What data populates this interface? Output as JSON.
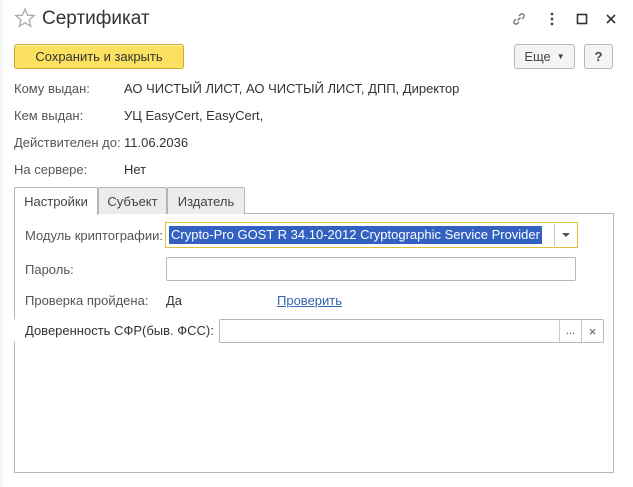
{
  "window": {
    "title": "Сертификат",
    "controls": [
      "link-icon",
      "more-vert-icon",
      "maximize-icon",
      "close-icon"
    ]
  },
  "toolbar": {
    "save_close_label": "Сохранить и закрыть",
    "more_label": "Еще",
    "help_label": "?"
  },
  "info": {
    "issued_to_label": "Кому выдан:",
    "issued_to_value": "АО ЧИСТЫЙ ЛИСТ, АО ЧИСТЫЙ ЛИСТ, ДПП, Директор",
    "issued_by_label": "Кем выдан:",
    "issued_by_value": "УЦ EasyCert, EasyCert,",
    "valid_until_label": "Действителен до:",
    "valid_until_value": "11.06.2036",
    "on_server_label": "На сервере:",
    "on_server_value": "Нет"
  },
  "tabs": [
    {
      "label": "Настройки",
      "active": true
    },
    {
      "label": "Субъект",
      "active": false
    },
    {
      "label": "Издатель",
      "active": false
    }
  ],
  "settings": {
    "crypto_module_label": "Модуль криптографии:",
    "crypto_module_value": "Crypto-Pro GOST R 34.10-2012 Cryptographic Service Provider",
    "password_label": "Пароль:",
    "password_value": "",
    "check_passed_label": "Проверка пройдена:",
    "check_passed_value": "Да",
    "check_link": "Проверить",
    "power_of_attorney_label": "Доверенность СФР(быв. ФСС):",
    "power_of_attorney_value": "",
    "select_btn": "...",
    "clear_btn": "×"
  },
  "colors": {
    "accent_button": "#fbe15f",
    "selection": "#3361c2",
    "focus_border": "#e0be40",
    "link": "#3366aa"
  }
}
